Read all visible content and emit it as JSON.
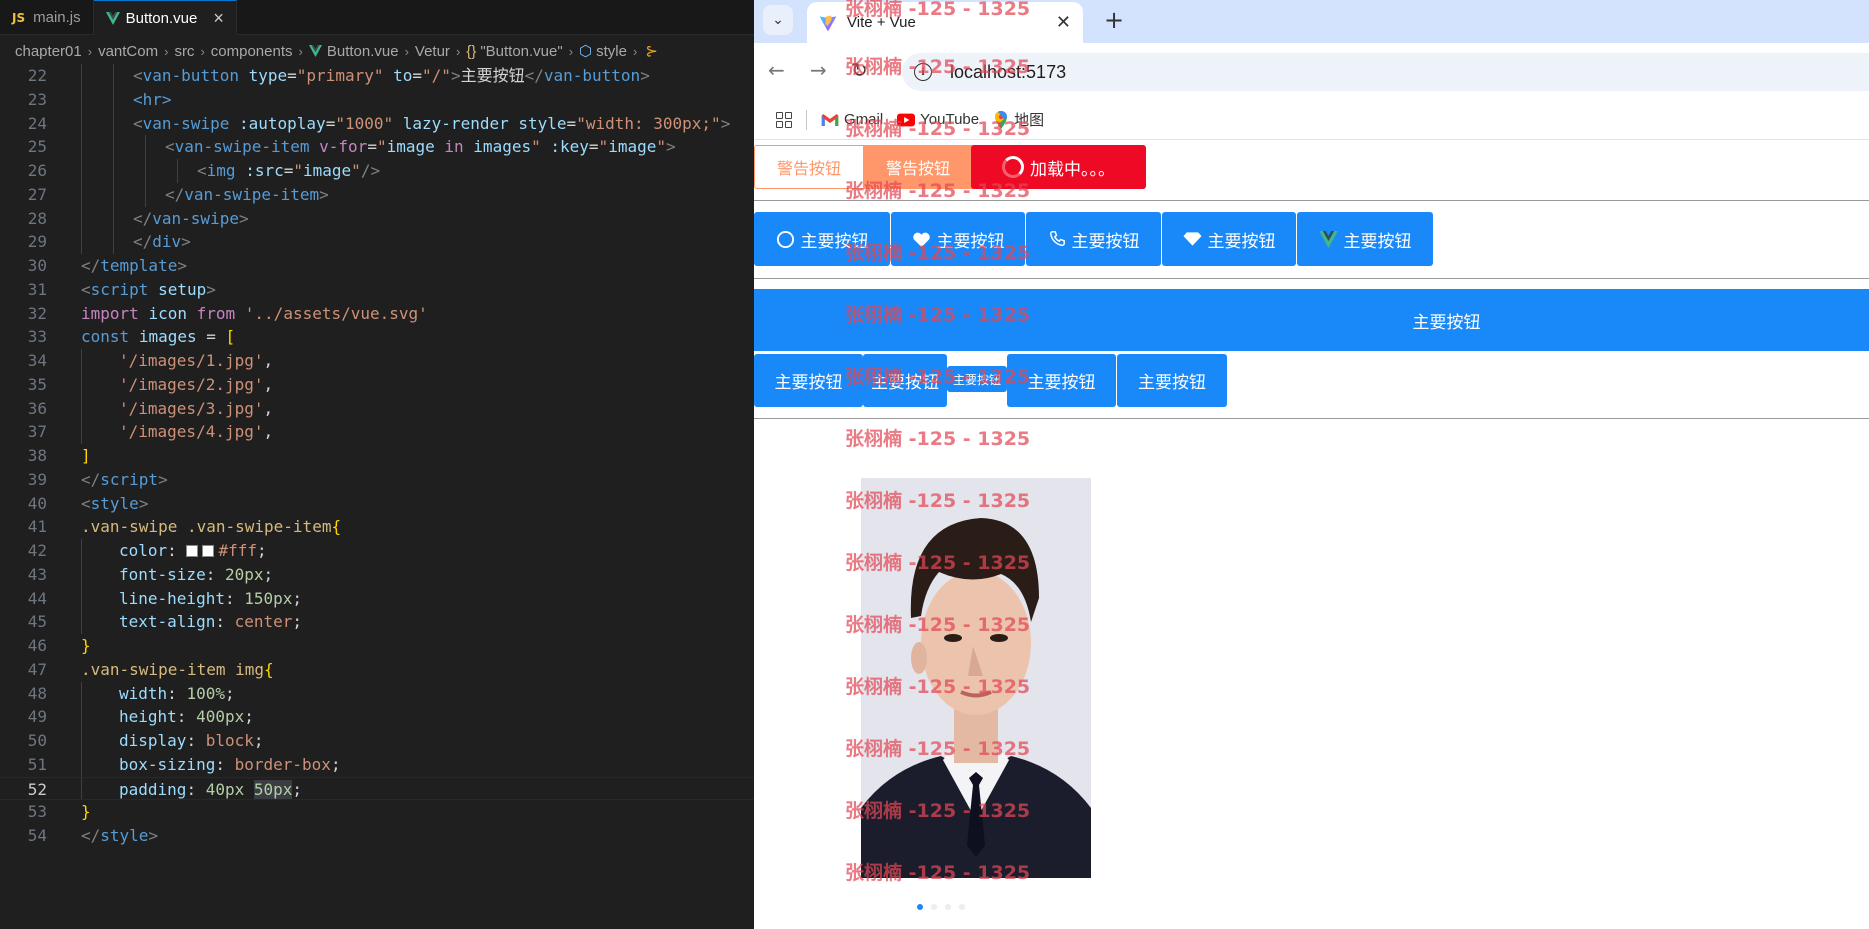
{
  "editor": {
    "tabs": [
      {
        "badge": "JS",
        "label": "main.js"
      },
      {
        "label": "Button.vue"
      }
    ],
    "breadcrumb": [
      "chapter01",
      "vantCom",
      "src",
      "components",
      "Button.vue",
      "Vetur",
      "\"Button.vue\"",
      "style"
    ],
    "breadcrumb_brace": "{}",
    "colors": {
      "keyword": "#c586c0",
      "tag": "#569cd6",
      "string": "#ce9178",
      "number": "#b5cea8",
      "selector": "#d7ba7d"
    },
    "lines": [
      {
        "n": "22"
      },
      {
        "n": "23"
      },
      {
        "n": "24"
      },
      {
        "n": "25"
      },
      {
        "n": "26"
      },
      {
        "n": "27"
      },
      {
        "n": "28"
      },
      {
        "n": "29"
      },
      {
        "n": "30"
      },
      {
        "n": "31"
      },
      {
        "n": "32"
      },
      {
        "n": "33"
      },
      {
        "n": "34"
      },
      {
        "n": "35"
      },
      {
        "n": "36"
      },
      {
        "n": "37"
      },
      {
        "n": "38"
      },
      {
        "n": "39"
      },
      {
        "n": "40"
      },
      {
        "n": "41"
      },
      {
        "n": "42"
      },
      {
        "n": "43"
      },
      {
        "n": "44"
      },
      {
        "n": "45"
      },
      {
        "n": "46"
      },
      {
        "n": "47"
      },
      {
        "n": "48"
      },
      {
        "n": "49"
      },
      {
        "n": "50"
      },
      {
        "n": "51"
      },
      {
        "n": "52"
      },
      {
        "n": "53"
      },
      {
        "n": "54"
      }
    ],
    "code": {
      "l22": {
        "open": "<",
        "tag": "van-button",
        "a1": "type",
        "eq": "=",
        "v1": "\"primary\"",
        "a2": "to",
        "v2": "\"/\"",
        "gt": ">",
        "text": "主要按钮",
        "close": "</",
        "ctag": "van-button",
        "cgt": ">"
      },
      "l23": {
        "tag": "<hr>"
      },
      "l24": {
        "open": "<",
        "tag": "van-swipe",
        "a1": ":autoplay",
        "v1": "\"1000\"",
        "a2": "lazy-render",
        "a3": "style",
        "v3": "\"width: 300px;\"",
        "gt": ">"
      },
      "l25": {
        "open": "<",
        "tag": "van-swipe-item",
        "a1": "v-for",
        "v1a": "\"",
        "v1b": "image",
        "v1c": " in ",
        "v1d": "images",
        "v1e": "\"",
        "a2": ":key",
        "v2a": "\"",
        "v2b": "image",
        "v2c": "\"",
        "gt": ">"
      },
      "l26": {
        "open": "<",
        "tag": "img",
        "a1": ":src",
        "v1a": "\"",
        "v1b": "image",
        "v1c": "\"",
        "end": "/>"
      },
      "l27": {
        "close": "</",
        "tag": "van-swipe-item",
        "gt": ">"
      },
      "l28": {
        "close": "</",
        "tag": "van-swipe",
        "gt": ">"
      },
      "l29": {
        "close": "</",
        "tag": "div",
        "gt": ">"
      },
      "l30": {
        "close": "</",
        "tag": "template",
        "gt": ">"
      },
      "l31": {
        "open": "<",
        "tag": "script",
        "a1": "setup",
        "gt": ">"
      },
      "l32": {
        "kw": "import",
        "id": "icon",
        "kw2": "from",
        "str": "'../assets/vue.svg'"
      },
      "l33": {
        "kw": "const",
        "id": "images",
        "op": "=",
        "br": "["
      },
      "l34": {
        "str": "'/images/1.jpg'",
        "comma": ","
      },
      "l35": {
        "str": "'/images/2.jpg'",
        "comma": ","
      },
      "l36": {
        "str": "'/images/3.jpg'",
        "comma": ","
      },
      "l37": {
        "str": "'/images/4.jpg'",
        "comma": ","
      },
      "l38": {
        "br": "]"
      },
      "l39": {
        "close": "</",
        "tag": "script",
        "gt": ">"
      },
      "l40": {
        "open": "<",
        "tag": "style",
        "gt": ">"
      },
      "l41": {
        "sel": ".van-swipe .van-swipe-item",
        "br": "{"
      },
      "l42": {
        "prop": "color",
        "colon": ":",
        "val": "#fff",
        "semi": ";"
      },
      "l43": {
        "prop": "font-size",
        "colon": ":",
        "num": "20px",
        "semi": ";"
      },
      "l44": {
        "prop": "line-height",
        "colon": ":",
        "num": "150px",
        "semi": ";"
      },
      "l45": {
        "prop": "text-align",
        "colon": ":",
        "val": "center",
        "semi": ";"
      },
      "l46": {
        "br": "}"
      },
      "l47": {
        "sel": ".van-swipe-item img",
        "br": "{"
      },
      "l48": {
        "prop": "width",
        "colon": ":",
        "num": "100%",
        "semi": ";"
      },
      "l49": {
        "prop": "height",
        "colon": ":",
        "num": "400px",
        "semi": ";"
      },
      "l50": {
        "prop": "display",
        "colon": ":",
        "val": "block",
        "semi": ";"
      },
      "l51": {
        "prop": "box-sizing",
        "colon": ":",
        "val": "border-box",
        "semi": ";"
      },
      "l52": {
        "prop": "padding",
        "colon": ":",
        "num": "40px",
        "num2": "50px",
        "semi": ";"
      },
      "l53": {
        "br": "}"
      },
      "l54": {
        "close": "</",
        "tag": "style",
        "gt": ">"
      }
    }
  },
  "browser": {
    "tab_title": "Vite + Vue",
    "url": "localhost:5173",
    "bookmarks": [
      "Gmail",
      "YouTube",
      "地图"
    ],
    "row1": [
      "警告按钮",
      "警告按钮",
      "加载中。。。"
    ],
    "row2": [
      "主要按钮",
      "主要按钮",
      "主要按钮",
      "主要按钮",
      "主要按钮"
    ],
    "row3": "主要按钮",
    "row4": [
      "主要按钮",
      "主要按钮",
      "主要按钮",
      "主要按钮",
      "主要按钮"
    ],
    "watermark": "张栩楠 -125 - 1325",
    "swipe_active_index": 1,
    "colors": {
      "primary": "#1989fa",
      "warning": "#ff976a",
      "danger": "#ee0a24"
    }
  }
}
